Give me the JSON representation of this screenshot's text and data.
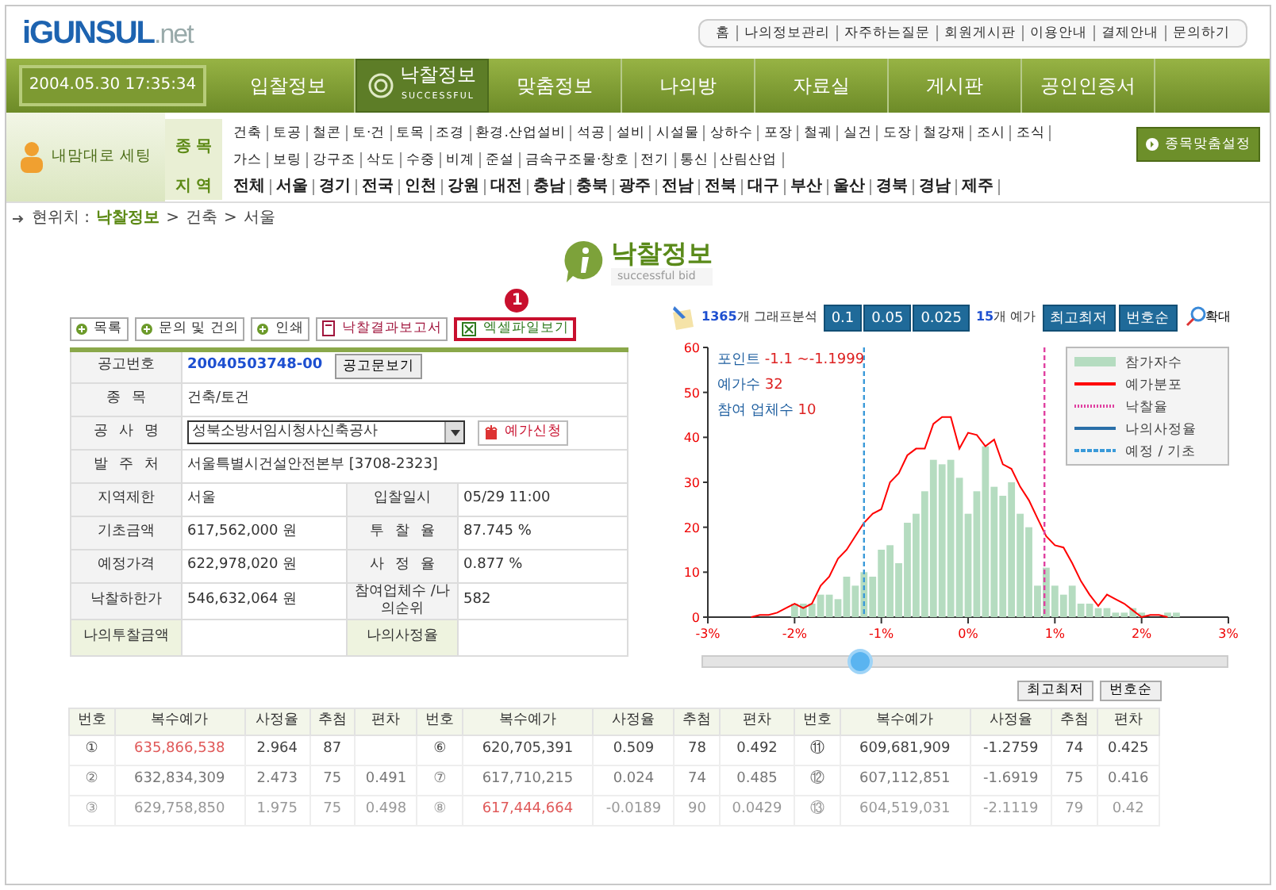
{
  "logo": {
    "name": "iGUNSUL",
    "suffix": ".net"
  },
  "top_links": [
    "홈",
    "나의정보관리",
    "자주하는질문",
    "회원게시판",
    "이용안내",
    "결제안내",
    "문의하기"
  ],
  "datetime": "2004.05.30 17:35:34",
  "nav": [
    {
      "label": "입찰정보",
      "selected": false
    },
    {
      "label": "낙찰정보",
      "sub": "SUCCESSFUL",
      "selected": true
    },
    {
      "label": "맞춤정보",
      "selected": false
    },
    {
      "label": "나의방",
      "selected": false
    },
    {
      "label": "자료실",
      "selected": false
    },
    {
      "label": "게시판",
      "selected": false
    },
    {
      "label": "공인인증서",
      "selected": false
    }
  ],
  "settings_button": "내맘대로 세팅",
  "filters": [
    {
      "label": "종 목",
      "rows": [
        [
          "건축",
          "토공",
          "철콘",
          "토·건",
          "토목",
          "조경",
          "환경.산업설비",
          "석공",
          "설비",
          "시설물",
          "상하수",
          "포장",
          "철궤",
          "실건",
          "도장",
          "철강재",
          "조시",
          "조식"
        ],
        [
          "가스",
          "보링",
          "강구조",
          "삭도",
          "수중",
          "비계",
          "준설",
          "금속구조물·창호",
          "전기",
          "통신",
          "산림산업"
        ]
      ]
    },
    {
      "label": "지 역",
      "rows": [
        [
          "전체",
          "서울",
          "경기",
          "전국",
          "인천",
          "강원",
          "대전",
          "충남",
          "충북",
          "광주",
          "전남",
          "전북",
          "대구",
          "부산",
          "울산",
          "경북",
          "경남",
          "제주"
        ]
      ]
    }
  ],
  "custom_button": "종목맞춤설정",
  "breadcrumb": {
    "prefix": "현위치 :",
    "separator": ">",
    "items": [
      "낙찰정보",
      "건축",
      "서울"
    ]
  },
  "page_title": {
    "title": "낙찰정보",
    "subtitle": "successful bid"
  },
  "actions": [
    {
      "label": "목록",
      "kind": "plus",
      "highlighted": false
    },
    {
      "label": "문의 및 건의",
      "kind": "plus",
      "highlighted": false
    },
    {
      "label": "인쇄",
      "kind": "plus",
      "highlighted": false
    },
    {
      "label": "낙찰결과보고서",
      "kind": "report",
      "highlighted": false
    },
    {
      "label": "엑셀파일보기",
      "kind": "excel",
      "highlighted": true,
      "callout": "1"
    }
  ],
  "info_rows": [
    {
      "kind": "notice",
      "label": "공고번호",
      "value": "20040503748-00",
      "button": "공고문보기"
    },
    {
      "kind": "text",
      "label": "종 목",
      "value": "건축/토건"
    },
    {
      "kind": "select",
      "label": "공 사 명",
      "value": "성북소방서임시청사신축공사",
      "button": "예가신청"
    },
    {
      "kind": "text",
      "label": "발 주 처",
      "value": "서울특별시건설안전본부 [3708-2323]"
    },
    {
      "kind": "pair",
      "cells": [
        {
          "label": "지역제한",
          "value": "서울"
        },
        {
          "label": "입찰일시",
          "value": "05/29 11:00"
        }
      ]
    },
    {
      "kind": "pair",
      "cells": [
        {
          "label": "기초금액",
          "value": "617,562,000 원"
        },
        {
          "label": "투 찰 율",
          "value": "87.745 %"
        }
      ]
    },
    {
      "kind": "pair",
      "cells": [
        {
          "label": "예정가격",
          "value": "622,978,020 원"
        },
        {
          "label": "사 정 율",
          "value": "0.877 %"
        }
      ]
    },
    {
      "kind": "pair",
      "cells": [
        {
          "label": "낙찰하한가",
          "value": "546,632,064 원"
        },
        {
          "label": "참여업체수 /나의순위",
          "value": "582"
        }
      ]
    },
    {
      "kind": "mine",
      "cells": [
        {
          "label": "나의투찰금액"
        },
        {
          "label": "나의사정율"
        }
      ]
    }
  ],
  "chart_toolbar": {
    "count": "1365",
    "count_label": "개 그래프분석",
    "steps": [
      "0.1",
      "0.05",
      "0.025"
    ],
    "price_count": "15",
    "price_label": "개 예가",
    "buttons": [
      "최고최저",
      "번호순"
    ],
    "zoom": "확대"
  },
  "chart_notes": [
    {
      "label": "포인트",
      "value": "-1.1 ~-1.1999"
    },
    {
      "label": "예가수",
      "value": "32"
    },
    {
      "label": "참여 업체수",
      "value": "10"
    }
  ],
  "chart_legend": [
    {
      "label": "낙찰율",
      "kind": "dotted",
      "color": "#e040a0"
    },
    {
      "label": "나의사정율",
      "kind": "line",
      "color": "#2a6fa8"
    },
    {
      "label": "예정 / 기초",
      "kind": "dashed",
      "color": "#3a9ad9"
    }
  ],
  "chart_data": {
    "type": "bar",
    "xlim": [
      -3,
      3
    ],
    "ylim": [
      0,
      60
    ],
    "xticks": [
      {
        "value": -3,
        "label": "-3%"
      },
      {
        "value": -2,
        "label": "-2%"
      },
      {
        "value": -1,
        "label": "-1%"
      },
      {
        "value": 0,
        "label": "0%"
      },
      {
        "value": 1,
        "label": "1%"
      },
      {
        "value": 2,
        "label": "2%"
      },
      {
        "value": 3,
        "label": "3%"
      }
    ],
    "yticks": [
      0,
      10,
      20,
      30,
      40,
      50,
      60
    ],
    "x": [
      -2.5,
      -2.4,
      -2.3,
      -2.2,
      -2.1,
      -2.0,
      -1.9,
      -1.8,
      -1.7,
      -1.6,
      -1.5,
      -1.4,
      -1.3,
      -1.2,
      -1.1,
      -1.0,
      -0.9,
      -0.8,
      -0.7,
      -0.6,
      -0.5,
      -0.4,
      -0.3,
      -0.2,
      -0.1,
      0.0,
      0.1,
      0.2,
      0.3,
      0.4,
      0.5,
      0.6,
      0.7,
      0.8,
      0.9,
      1.0,
      1.1,
      1.2,
      1.3,
      1.4,
      1.5,
      1.6,
      1.7,
      1.8,
      1.9,
      2.0,
      2.1,
      2.2,
      2.3,
      2.4
    ],
    "series": [
      {
        "name": "참가자수",
        "type": "bar",
        "color": "#b5dcc0",
        "values": [
          null,
          null,
          null,
          null,
          null,
          3,
          3,
          3,
          5,
          5,
          4,
          9,
          7,
          10,
          9,
          15,
          16,
          12,
          21,
          23,
          28,
          35,
          34,
          35,
          31,
          23,
          28,
          38,
          29,
          27,
          30,
          23,
          20,
          7,
          11,
          7,
          5,
          7,
          3,
          3,
          2,
          2,
          1,
          1,
          2,
          1,
          0,
          0,
          1,
          1
        ]
      },
      {
        "name": "예가분포",
        "type": "line",
        "color": "#ff0000",
        "values": [
          0,
          0.5,
          0.5,
          1,
          2,
          3,
          2,
          3,
          7,
          9,
          13,
          15,
          18,
          21,
          23,
          24,
          30,
          32,
          36,
          37.5,
          37.5,
          43,
          44.5,
          44.5,
          37.5,
          41,
          40.5,
          38,
          39.5,
          34,
          33,
          29,
          26,
          22,
          18,
          16,
          15.5,
          12,
          8,
          5,
          2.5,
          5,
          4,
          3,
          1.5,
          0,
          0.5,
          0.5,
          0,
          null
        ]
      }
    ],
    "legend": true,
    "ref_lines": [
      {
        "axis": "x",
        "value": -1.2,
        "color": "#3a9ad9"
      },
      {
        "axis": "x",
        "value": 0.88,
        "color": "#e040a0"
      }
    ]
  },
  "slider": {
    "level": 0.3
  },
  "table_buttons": [
    "최고최저",
    "번호순"
  ],
  "price_table": {
    "columns": [
      "번호",
      "복수예가",
      "사정율",
      "추첨",
      "편차",
      "번호",
      "복수예가",
      "사정율",
      "추첨",
      "편차",
      "번호",
      "복수예가",
      "사정율",
      "추첨",
      "편차"
    ],
    "rows": [
      {
        "groups": [
          {
            "no": "①",
            "price": "635,866,538",
            "rate": "2.964",
            "draw": "87",
            "highlighted": true
          },
          {
            "no": "⑥",
            "price": "620,705,391",
            "rate": "0.509",
            "draw": "78",
            "dev": "0.492",
            "highlighted": false
          },
          {
            "no": "⑪",
            "price": "609,681,909",
            "rate": "-1.2759",
            "draw": "74",
            "dev": "0.425",
            "highlighted": false
          }
        ]
      },
      {
        "groups": [
          {
            "no": "②",
            "price": "632,834,309",
            "rate": "2.473",
            "draw": "75",
            "dev": "0.491",
            "highlighted": false
          },
          {
            "no": "⑦",
            "price": "617,710,215",
            "rate": "0.024",
            "draw": "74",
            "dev": "0.485",
            "highlighted": false
          },
          {
            "no": "⑫",
            "price": "607,112,851",
            "rate": "-1.6919",
            "draw": "75",
            "dev": "0.416",
            "highlighted": false
          }
        ]
      },
      {
        "groups": [
          {
            "no": "③",
            "price": "629,758,850",
            "rate": "1.975",
            "draw": "75",
            "dev": "0.498",
            "highlighted": false
          },
          {
            "no": "⑧",
            "price": "617,444,664",
            "rate": "-0.0189",
            "draw": "90",
            "dev": "0.0429",
            "highlighted": true
          },
          {
            "no": "⑬",
            "price": "604,519,031",
            "rate": "-2.1119",
            "draw": "79",
            "dev": "0.42",
            "highlighted": false
          }
        ]
      }
    ]
  }
}
